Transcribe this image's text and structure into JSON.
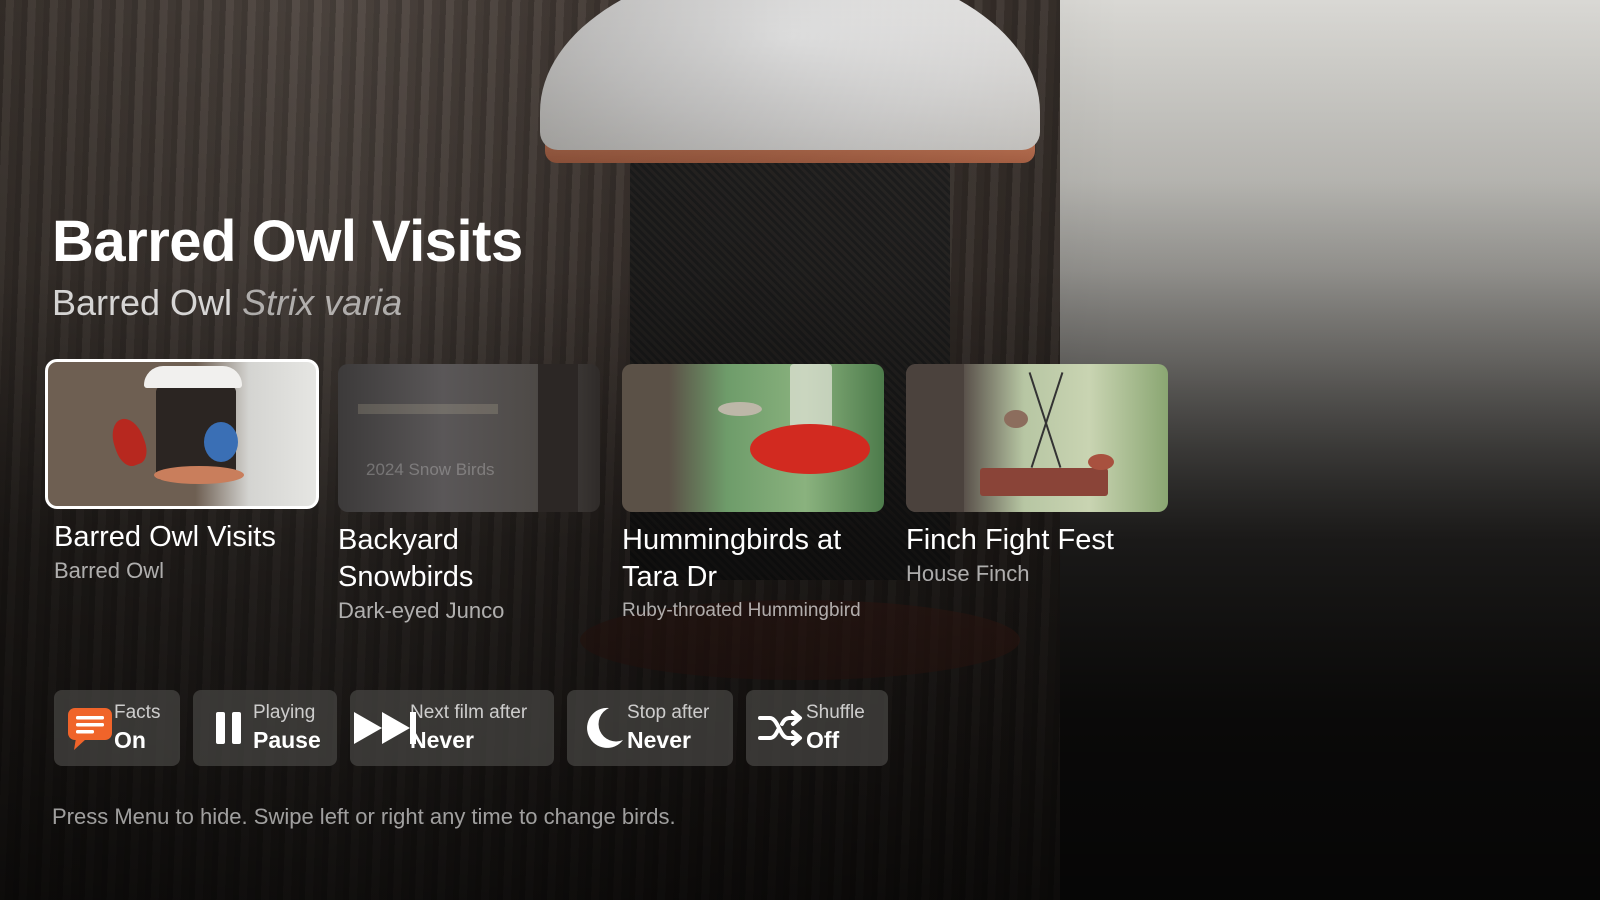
{
  "hero": {
    "title": "Barred Owl Visits",
    "common_name": "Barred Owl",
    "scientific_name": "Strix varia"
  },
  "films": [
    {
      "title": "Barred Owl Visits",
      "species": "Barred Owl",
      "selected": true
    },
    {
      "title": "Backyard Snowbirds",
      "species": "Dark-eyed Junco",
      "watermark": "2024 Snow Birds",
      "selected": false
    },
    {
      "title": "Hummingbirds at Tara Dr",
      "species": "Ruby-throated Hummingbird",
      "selected": false
    },
    {
      "title": "Finch Fight Fest",
      "species": "House Finch",
      "selected": false
    }
  ],
  "controls": {
    "facts": {
      "label": "Facts",
      "value": "On",
      "icon": "chat-bubble-icon",
      "color": "#f0642a"
    },
    "playing": {
      "label": "Playing",
      "value": "Pause",
      "icon": "pause-icon"
    },
    "next_film": {
      "label": "Next film after",
      "value": "Never",
      "icon": "fast-forward-icon"
    },
    "stop_after": {
      "label": "Stop after",
      "value": "Never",
      "icon": "moon-icon"
    },
    "shuffle": {
      "label": "Shuffle",
      "value": "Off",
      "icon": "shuffle-icon"
    }
  },
  "hint": "Press Menu to hide. Swipe left or right any time to change birds."
}
